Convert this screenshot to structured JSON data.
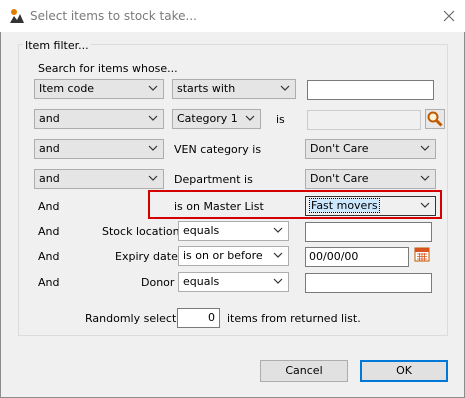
{
  "window": {
    "title": "Select items to stock take..."
  },
  "filter": {
    "group_label": "Item filter...",
    "search_label": "Search for items whose...",
    "row1": {
      "field": "Item code",
      "operator": "starts with",
      "value": ""
    },
    "row2": {
      "conj": "and",
      "field": "Category 1",
      "is_label": "is",
      "value": ""
    },
    "row3": {
      "conj": "and",
      "label": "VEN category is",
      "value": "Don't Care"
    },
    "row4": {
      "conj": "and",
      "label": "Department is",
      "value": "Don't Care"
    },
    "row5": {
      "conj": "And",
      "label": "is on Master List",
      "value": "Fast movers"
    },
    "row6": {
      "conj": "And",
      "label": "Stock location",
      "operator": "equals",
      "value": ""
    },
    "row7": {
      "conj": "And",
      "label": "Expiry date",
      "operator": "is on or before",
      "value": "00/00/00"
    },
    "row8": {
      "conj": "And",
      "label": "Donor",
      "operator": "equals",
      "value": ""
    },
    "random": {
      "prefix": "Randomly select",
      "count": "0",
      "suffix": "items from returned list."
    }
  },
  "buttons": {
    "cancel": "Cancel",
    "ok": "OK"
  },
  "colors": {
    "highlight": "#d40000",
    "focus": "#cce8ff",
    "default_button_border": "#0078d7"
  },
  "icons": {
    "app": "msupply-logo-icon",
    "search": "magnifier-icon",
    "calendar": "calendar-icon",
    "dropdown": "chevron-down-icon"
  }
}
